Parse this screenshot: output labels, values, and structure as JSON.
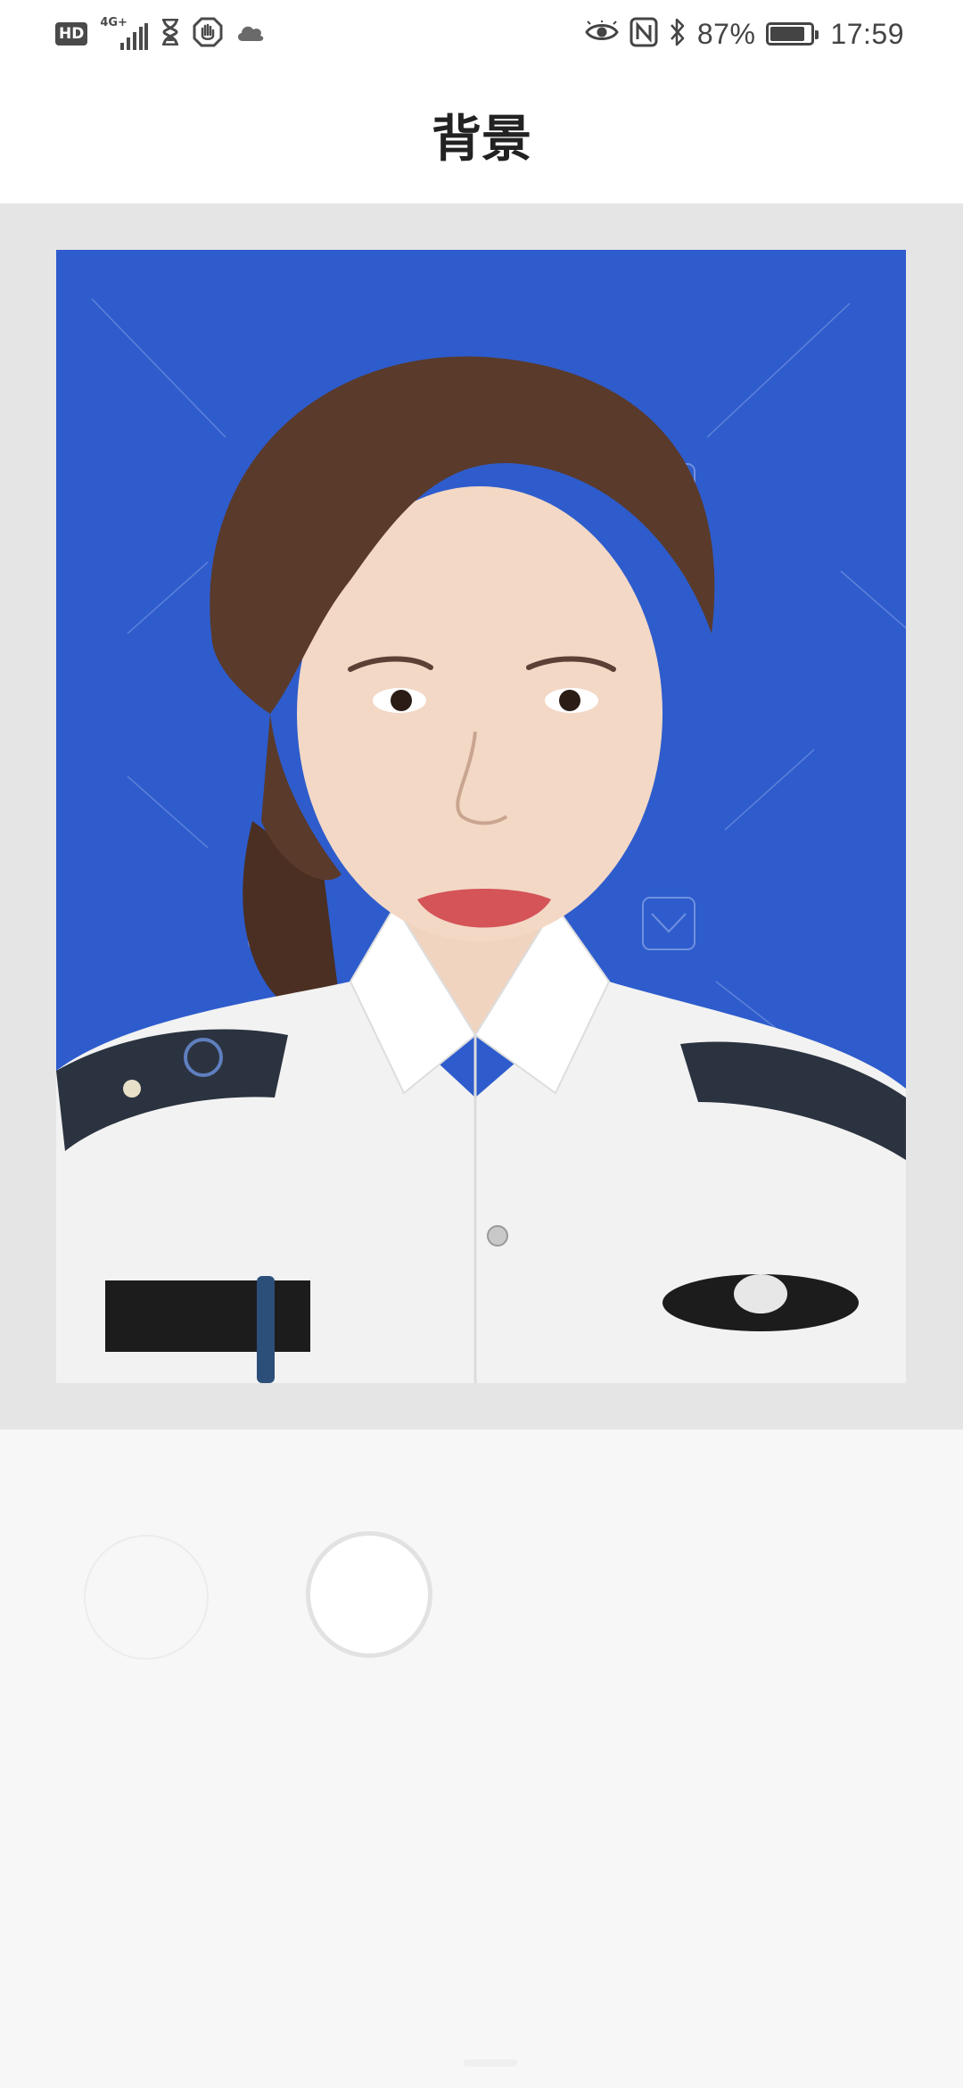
{
  "status_bar": {
    "hd_badge": "HD",
    "network_type": "4G+",
    "battery_percent": "87%",
    "battery_level": 0.87,
    "time": "17:59",
    "left_icons": [
      "hd-icon",
      "signal-4g-icon",
      "hourglass-icon",
      "hand-stop-icon",
      "cloud-icon"
    ],
    "right_icons": [
      "eye-icon",
      "nfc-icon",
      "bluetooth-icon",
      "battery-icon"
    ]
  },
  "header": {
    "title": "背景"
  },
  "colors": {
    "preview_background": "#e5e5e5",
    "photo_background_blue": "#2e5ccc",
    "tools_background": "#f7f7f7"
  },
  "tools": {
    "background_options": [
      "swatch-1",
      "swatch-2"
    ]
  }
}
